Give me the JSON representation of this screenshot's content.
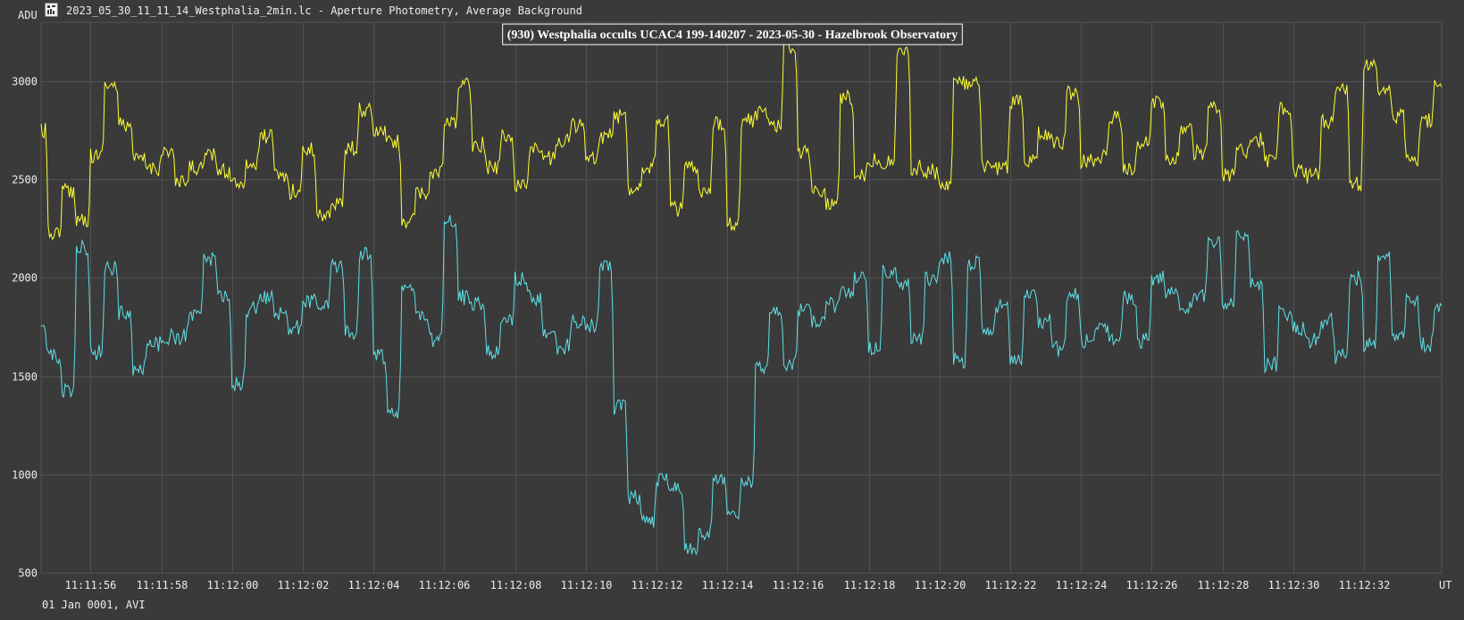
{
  "window": {
    "title": "2023_05_30_11_11_14_Westphalia_2min.lc - Aperture Photometry, Average Background",
    "icon": "lightcurve-app-icon"
  },
  "footer": {
    "date_label": "01 Jan 0001, AVI"
  },
  "colors": {
    "background": "#3a3a3a",
    "grid": "#525252",
    "target": "#ffff33",
    "comparison": "#5ee0e6"
  },
  "chart_data": {
    "type": "line",
    "title": "(930) Westphalia occults UCAC4 199-140207 - 2023-05-30 - Hazelbrook Observatory",
    "ylabel": "ADU",
    "xlabel": "UT",
    "x_range": [
      "11:11:54.6",
      "11:12:34.2"
    ],
    "ylim": [
      500,
      3300
    ],
    "grid": true,
    "y_ticks": [
      500,
      1000,
      1500,
      2000,
      2500,
      3000
    ],
    "x_ticks": [
      "11:11:56",
      "11:11:58",
      "11:12:00",
      "11:12:02",
      "11:12:04",
      "11:12:06",
      "11:12:08",
      "11:12:10",
      "11:12:12",
      "11:12:14",
      "11:12:16",
      "11:12:18",
      "11:12:20",
      "11:12:22",
      "11:12:24",
      "11:12:26",
      "11:12:28",
      "11:12:30",
      "11:12:32"
    ],
    "series": [
      {
        "color": "#ffff33",
        "x": [
          "11:11:54.6",
          "11:11:55.0",
          "11:11:55.4",
          "11:11:55.8",
          "11:11:56.2",
          "11:11:56.6",
          "11:11:57.0",
          "11:11:57.4",
          "11:11:57.8",
          "11:11:58.2",
          "11:11:58.6",
          "11:11:59.0",
          "11:11:59.4",
          "11:11:59.8",
          "11:12:00.2",
          "11:12:00.6",
          "11:12:01.0",
          "11:12:01.4",
          "11:12:01.8",
          "11:12:02.2",
          "11:12:02.6",
          "11:12:03.0",
          "11:12:03.4",
          "11:12:03.8",
          "11:12:04.2",
          "11:12:04.6",
          "11:12:05.0",
          "11:12:05.4",
          "11:12:05.8",
          "11:12:06.2",
          "11:12:06.6",
          "11:12:07.0",
          "11:12:07.4",
          "11:12:07.8",
          "11:12:08.2",
          "11:12:08.6",
          "11:12:09.0",
          "11:12:09.4",
          "11:12:09.8",
          "11:12:10.2",
          "11:12:10.6",
          "11:12:11.0",
          "11:12:11.4",
          "11:12:11.8",
          "11:12:12.2",
          "11:12:12.6",
          "11:12:13.0",
          "11:12:13.4",
          "11:12:13.8",
          "11:12:14.2",
          "11:12:14.6",
          "11:12:15.0",
          "11:12:15.4",
          "11:12:15.8",
          "11:12:16.2",
          "11:12:16.6",
          "11:12:17.0",
          "11:12:17.4",
          "11:12:17.8",
          "11:12:18.2",
          "11:12:18.6",
          "11:12:19.0",
          "11:12:19.4",
          "11:12:19.8",
          "11:12:20.2",
          "11:12:20.6",
          "11:12:21.0",
          "11:12:21.4",
          "11:12:21.8",
          "11:12:22.2",
          "11:12:22.6",
          "11:12:23.0",
          "11:12:23.4",
          "11:12:23.8",
          "11:12:24.2",
          "11:12:24.6",
          "11:12:25.0",
          "11:12:25.4",
          "11:12:25.8",
          "11:12:26.2",
          "11:12:26.6",
          "11:12:27.0",
          "11:12:27.4",
          "11:12:27.8",
          "11:12:28.2",
          "11:12:28.6",
          "11:12:29.0",
          "11:12:29.4",
          "11:12:29.8",
          "11:12:30.2",
          "11:12:30.6",
          "11:12:31.0",
          "11:12:31.4",
          "11:12:31.8",
          "11:12:32.2",
          "11:12:32.6",
          "11:12:33.0",
          "11:12:33.4",
          "11:12:33.8",
          "11:12:34.2"
        ],
        "values": [
          2750,
          2230,
          2440,
          2300,
          2620,
          2980,
          2780,
          2600,
          2560,
          2640,
          2480,
          2560,
          2620,
          2540,
          2490,
          2580,
          2720,
          2520,
          2440,
          2650,
          2320,
          2380,
          2660,
          2850,
          2740,
          2690,
          2290,
          2420,
          2530,
          2780,
          2980,
          2680,
          2560,
          2720,
          2470,
          2650,
          2610,
          2700,
          2780,
          2600,
          2720,
          2820,
          2460,
          2570,
          2800,
          2350,
          2560,
          2420,
          2790,
          2280,
          2800,
          2840,
          2780,
          3180,
          2640,
          2450,
          2380,
          2920,
          2530,
          2600,
          2590,
          3150,
          2560,
          2540,
          2480,
          2990,
          2980,
          2560,
          2560,
          2900,
          2590,
          2730,
          2680,
          2940,
          2590,
          2620,
          2810,
          2560,
          2680,
          2900,
          2600,
          2760,
          2640,
          2860,
          2520,
          2650,
          2700,
          2600,
          2860,
          2540,
          2520,
          2800,
          2960,
          2480,
          3080,
          2960,
          2820,
          2600,
          2800,
          2970
        ]
      },
      {
        "color": "#5ee0e6",
        "x": [
          "11:11:54.6",
          "11:11:55.0",
          "11:11:55.4",
          "11:11:55.8",
          "11:11:56.2",
          "11:11:56.6",
          "11:11:57.0",
          "11:11:57.4",
          "11:11:57.8",
          "11:11:58.2",
          "11:11:58.6",
          "11:11:59.0",
          "11:11:59.4",
          "11:11:59.8",
          "11:12:00.2",
          "11:12:00.6",
          "11:12:01.0",
          "11:12:01.4",
          "11:12:01.8",
          "11:12:02.2",
          "11:12:02.6",
          "11:12:03.0",
          "11:12:03.4",
          "11:12:03.8",
          "11:12:04.2",
          "11:12:04.6",
          "11:12:05.0",
          "11:12:05.4",
          "11:12:05.8",
          "11:12:06.2",
          "11:12:06.6",
          "11:12:07.0",
          "11:12:07.4",
          "11:12:07.8",
          "11:12:08.2",
          "11:12:08.6",
          "11:12:09.0",
          "11:12:09.4",
          "11:12:09.8",
          "11:12:10.2",
          "11:12:10.6",
          "11:12:11.0",
          "11:12:11.4",
          "11:12:11.8",
          "11:12:12.2",
          "11:12:12.6",
          "11:12:13.0",
          "11:12:13.4",
          "11:12:13.8",
          "11:12:14.2",
          "11:12:14.6",
          "11:12:15.0",
          "11:12:15.4",
          "11:12:15.8",
          "11:12:16.2",
          "11:12:16.6",
          "11:12:17.0",
          "11:12:17.4",
          "11:12:17.8",
          "11:12:18.2",
          "11:12:18.6",
          "11:12:19.0",
          "11:12:19.4",
          "11:12:19.8",
          "11:12:20.2",
          "11:12:20.6",
          "11:12:21.0",
          "11:12:21.4",
          "11:12:21.8",
          "11:12:22.2",
          "11:12:22.6",
          "11:12:23.0",
          "11:12:23.4",
          "11:12:23.8",
          "11:12:24.2",
          "11:12:24.6",
          "11:12:25.0",
          "11:12:25.4",
          "11:12:25.8",
          "11:12:26.2",
          "11:12:26.6",
          "11:12:27.0",
          "11:12:27.4",
          "11:12:27.8",
          "11:12:28.2",
          "11:12:28.6",
          "11:12:29.0",
          "11:12:29.4",
          "11:12:29.8",
          "11:12:30.2",
          "11:12:30.6",
          "11:12:31.0",
          "11:12:31.4",
          "11:12:31.8",
          "11:12:32.2",
          "11:12:32.6",
          "11:12:33.0",
          "11:12:33.4",
          "11:12:33.8",
          "11:12:34.2"
        ],
        "values": [
          1720,
          1600,
          1420,
          2150,
          1620,
          2050,
          1820,
          1540,
          1660,
          1700,
          1700,
          1800,
          2100,
          1900,
          1460,
          1840,
          1900,
          1820,
          1750,
          1880,
          1870,
          2060,
          1720,
          2120,
          1600,
          1320,
          1950,
          1800,
          1680,
          2280,
          1900,
          1860,
          1620,
          1780,
          2000,
          1900,
          1700,
          1650,
          1780,
          1760,
          2050,
          1340,
          880,
          760,
          980,
          920,
          620,
          700,
          980,
          800,
          960,
          1540,
          1820,
          1560,
          1840,
          1780,
          1860,
          1920,
          1990,
          1650,
          2040,
          1960,
          1700,
          2000,
          2100,
          1580,
          2080,
          1740,
          1860,
          1580,
          1900,
          1780,
          1640,
          1920,
          1680,
          1740,
          1700,
          1900,
          1680,
          2000,
          1920,
          1860,
          1900,
          2180,
          1860,
          2220,
          1960,
          1560,
          1820,
          1740,
          1680,
          1780,
          1600,
          2000,
          1660,
          2100,
          1700,
          1880,
          1660,
          1860
        ]
      }
    ]
  }
}
